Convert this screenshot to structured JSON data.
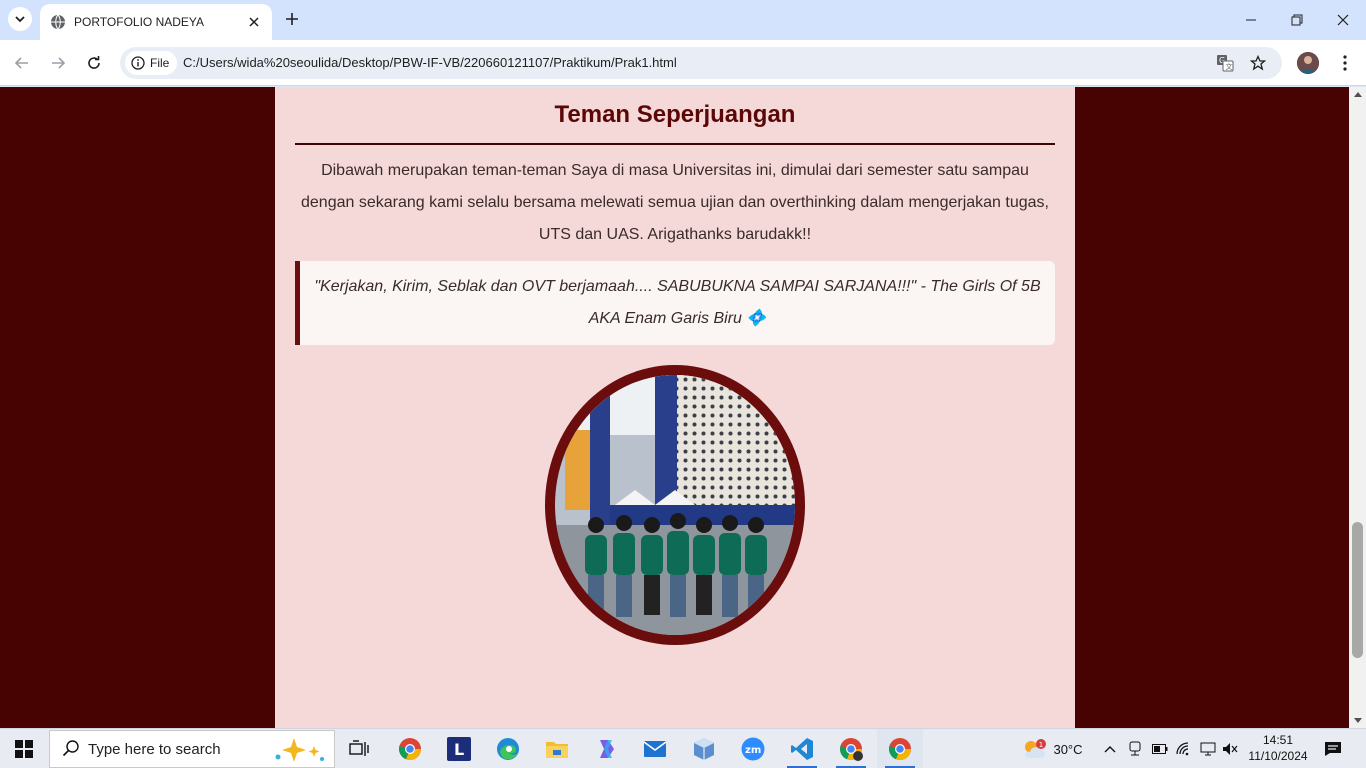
{
  "browser": {
    "tab": {
      "title": "PORTOFOLIO NADEYA",
      "favicon": "globe-icon"
    },
    "omnibox": {
      "chip_label": "File",
      "url": "C:/Users/wida%20seoulida/Desktop/PBW-IF-VB/220660121107/Praktikum/Prak1.html"
    },
    "icons": [
      "tab-search-icon",
      "close-icon",
      "plus-icon",
      "minimize-icon",
      "restore-icon",
      "close-window-icon",
      "back-icon",
      "forward-icon",
      "reload-icon",
      "info-icon",
      "translate-icon",
      "star-icon",
      "avatar",
      "kebab-menu-icon"
    ]
  },
  "page": {
    "section_title": "Teman Seperjuangan",
    "intro": "Dibawah merupakan teman-teman Saya di masa Universitas ini, dimulai dari semester satu sampau dengan sekarang kami selalu bersama melewati semua ujian dan overthinking dalam mengerjakan tugas, UTS dan UAS. Arigathanks barudakk!!",
    "quote": "\"Kerjakan, Kirim, Seblak dan OVT berjamaah.... SABUBUKNA SAMPAI SARJANA!!!\" - The Girls Of 5B AKA Enam Garis Biru 💠",
    "colors": {
      "background": "#470202",
      "card": "#f5d8d8",
      "title": "#5c0707",
      "accent": "#6b0d0d"
    }
  },
  "taskbar": {
    "search_placeholder": "Type here to search",
    "apps": [
      "task-view-icon",
      "chrome-icon",
      "l-app-icon",
      "edge-icon",
      "file-explorer-icon",
      "copilot-icon",
      "mail-icon",
      "box-app-icon",
      "zoom-icon",
      "vscode-icon",
      "chrome-profile-icon",
      "chrome-active-icon"
    ],
    "weather": {
      "temp": "30°C",
      "badge": "1"
    },
    "clock": {
      "time": "14:51",
      "date": "11/10/2024"
    }
  }
}
